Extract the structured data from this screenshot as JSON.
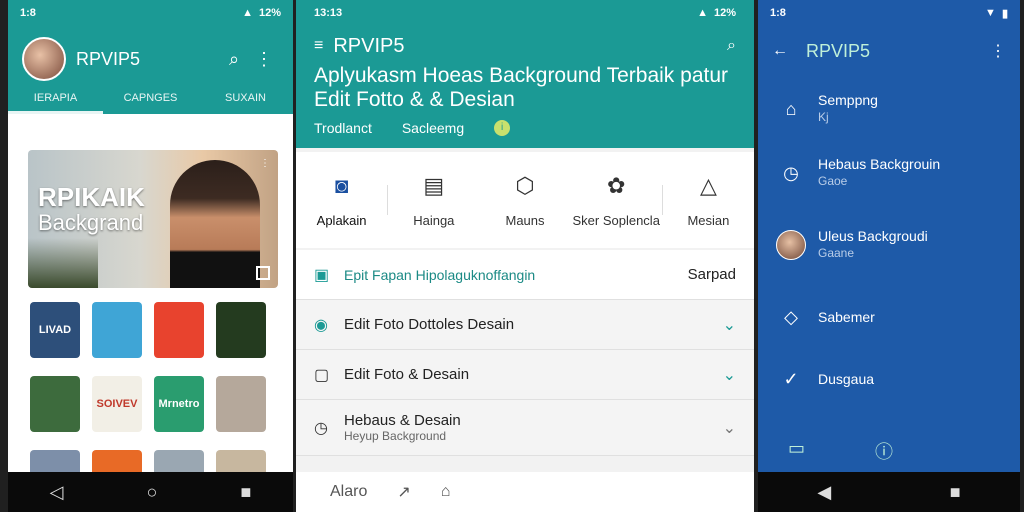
{
  "phone1": {
    "status": {
      "time": "1:8",
      "battery": "12%"
    },
    "title": "RPVIP5",
    "tabs": [
      "IERAPIA",
      "CAPNGES",
      "SUXAIN"
    ],
    "hero": {
      "line1": "RPIKAIK",
      "line2": "Backgrand"
    },
    "tiles": [
      {
        "label": "LIVAD",
        "color": "#2d4f7a"
      },
      {
        "label": "",
        "color": "#3fa5d6"
      },
      {
        "label": "",
        "color": "#e8432e"
      },
      {
        "label": "",
        "color": "#243b1f"
      },
      {
        "label": "",
        "color": "#3d6b3d"
      },
      {
        "label": "SOIVEV",
        "color": "#f2efe6"
      },
      {
        "label": "Mrnetro",
        "color": "#2a9d6f"
      },
      {
        "label": "",
        "color": "#b5a89b"
      },
      {
        "label": "",
        "color": "#7d8fa9"
      },
      {
        "label": "",
        "color": "#e86a26"
      },
      {
        "label": "",
        "color": "#9aa7b2"
      },
      {
        "label": "",
        "color": "#c7b79f"
      }
    ]
  },
  "phone2": {
    "status": {
      "time": "13:13",
      "battery": "12%"
    },
    "title": "RPVIP5",
    "headline": "Aplyukasm Hoeas Background Terbaik patur Edit Fotto & & Desian",
    "subs": [
      "Trodlanct",
      "Sacleemg"
    ],
    "categories": [
      {
        "label": "Aplakain",
        "icon": "camera-icon"
      },
      {
        "label": "Hainga",
        "icon": "calendar-icon"
      },
      {
        "label": "Mauns",
        "icon": "cube-icon"
      },
      {
        "label": "Sker Soplencla",
        "icon": "flower-icon"
      },
      {
        "label": "Mesian",
        "icon": "triangle-icon"
      }
    ],
    "list_head": {
      "label": "Epit Fapan Hipolaguknoffangin",
      "action": "Sarpad"
    },
    "items": [
      {
        "label": "Edit Foto Dottoles Desain",
        "sub": ""
      },
      {
        "label": "Edit Foto & Desain",
        "sub": ""
      },
      {
        "label": "Hebaus & Desain",
        "sub": "Heyup Background"
      }
    ],
    "bottom": [
      "Alaro"
    ]
  },
  "phone3": {
    "status": {
      "time": "1:8"
    },
    "title": "RPVIP5",
    "items": [
      {
        "title": "Semppng",
        "sub": "Kj"
      },
      {
        "title": "Hebaus Backgrouin",
        "sub": "Gaoe"
      },
      {
        "title": "Uleus Backgroudi",
        "sub": "Gaane"
      },
      {
        "title": "Sabemer",
        "sub": ""
      },
      {
        "title": "Dusgaua",
        "sub": ""
      }
    ]
  }
}
